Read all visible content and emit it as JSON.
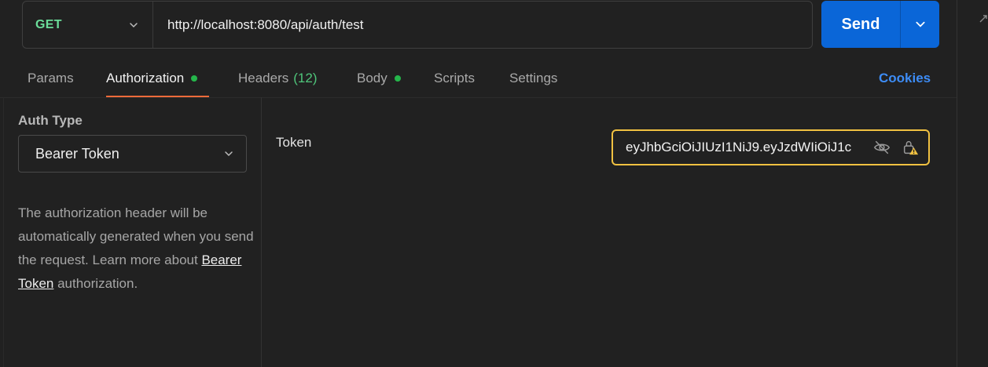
{
  "request": {
    "method": "GET",
    "url": "http://localhost:8080/api/auth/test",
    "send_label": "Send"
  },
  "tabs": [
    {
      "label": "Params"
    },
    {
      "label": "Authorization",
      "has_dot": true
    },
    {
      "label": "Headers",
      "count": "(12)"
    },
    {
      "label": "Body",
      "has_dot": true
    },
    {
      "label": "Scripts"
    },
    {
      "label": "Settings"
    }
  ],
  "cookies_label": "Cookies",
  "auth": {
    "type_label": "Auth Type",
    "type_value": "Bearer Token",
    "description_prefix": "The authorization header will be automatically generated when you send the request. Learn more about ",
    "description_link": "Bearer Token",
    "description_suffix": " authorization."
  },
  "token": {
    "label": "Token",
    "value": "eyJhbGciOiJIUzI1NiJ9.eyJzdWIiOiJ1c"
  },
  "colors": {
    "accent": "#0a66d8",
    "method_get": "#6bdd9a",
    "active_tab_underline": "#f26b3a",
    "token_border": "#f0c141",
    "status_dot": "#25b64b",
    "link": "#3d8cf5"
  },
  "icons": [
    "chevron-down-icon",
    "eye-off-icon",
    "lock-warning-icon",
    "expand-icon"
  ]
}
